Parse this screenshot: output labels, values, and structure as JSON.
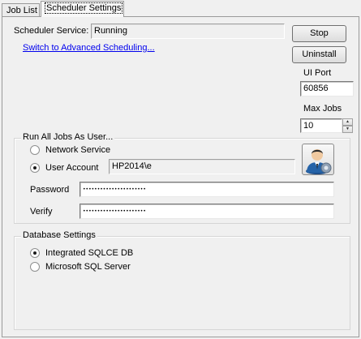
{
  "tabs": [
    {
      "label": "Job List",
      "active": false
    },
    {
      "label": "Scheduler Settings",
      "active": true
    }
  ],
  "scheduler": {
    "service_label": "Scheduler Service:",
    "service_status": "Running",
    "advanced_link": "Switch to Advanced Scheduling..."
  },
  "buttons": {
    "stop": "Stop",
    "uninstall": "Uninstall"
  },
  "ui_port": {
    "label": "UI Port",
    "value": "60856"
  },
  "max_jobs": {
    "label": "Max Jobs",
    "value": "10"
  },
  "run_as": {
    "title": "Run All Jobs As User...",
    "network_service": "Network Service",
    "user_account": "User Account",
    "selected": "user_account",
    "account_value": "HP2014\\e",
    "password_label": "Password",
    "password_value": "••••••••••••••••••••••",
    "verify_label": "Verify",
    "verify_value": "••••••••••••••••••••••",
    "user_icon": "user-settings-icon"
  },
  "database": {
    "title": "Database Settings",
    "integrated": "Integrated SQLCE DB",
    "sql_server": "Microsoft SQL Server",
    "selected": "integrated"
  },
  "colors": {
    "link": "#0000ee",
    "background": "#f0f0f0"
  }
}
